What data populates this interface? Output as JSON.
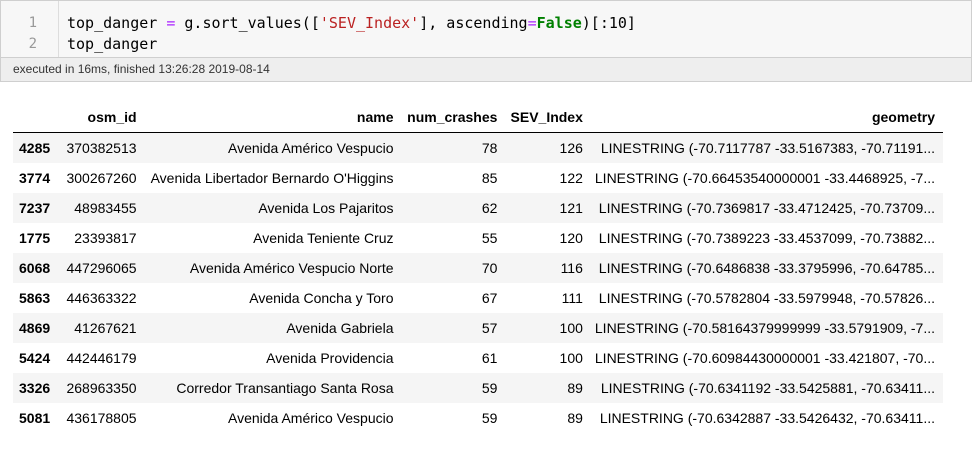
{
  "cell": {
    "line_numbers": [
      "1",
      "2"
    ],
    "code": {
      "line1": {
        "p1": "top_danger ",
        "eq1": "=",
        "p2": " g.sort_values([",
        "str": "'SEV_Index'",
        "p3": "], ascending",
        "eq2": "=",
        "kw": "False",
        "p4": ")[:10]"
      },
      "line2": "top_danger"
    },
    "execution_status": "executed in 16ms, finished 13:26:28 2019-08-14"
  },
  "table": {
    "columns": [
      "",
      "osm_id",
      "name",
      "num_crashes",
      "SEV_Index",
      "geometry"
    ],
    "rows": [
      {
        "index": "4285",
        "osm_id": "370382513",
        "name": "Avenida Américo Vespucio",
        "num_crashes": "78",
        "sev_index": "126",
        "geometry": "LINESTRING (-70.7117787 -33.5167383, -70.71191..."
      },
      {
        "index": "3774",
        "osm_id": "300267260",
        "name": "Avenida Libertador Bernardo O'Higgins",
        "num_crashes": "85",
        "sev_index": "122",
        "geometry": "LINESTRING (-70.66453540000001 -33.4468925, -7..."
      },
      {
        "index": "7237",
        "osm_id": "48983455",
        "name": "Avenida Los Pajaritos",
        "num_crashes": "62",
        "sev_index": "121",
        "geometry": "LINESTRING (-70.7369817 -33.4712425, -70.73709..."
      },
      {
        "index": "1775",
        "osm_id": "23393817",
        "name": "Avenida Teniente Cruz",
        "num_crashes": "55",
        "sev_index": "120",
        "geometry": "LINESTRING (-70.7389223 -33.4537099, -70.73882..."
      },
      {
        "index": "6068",
        "osm_id": "447296065",
        "name": "Avenida Américo Vespucio Norte",
        "num_crashes": "70",
        "sev_index": "116",
        "geometry": "LINESTRING (-70.6486838 -33.3795996, -70.64785..."
      },
      {
        "index": "5863",
        "osm_id": "446363322",
        "name": "Avenida Concha y Toro",
        "num_crashes": "67",
        "sev_index": "111",
        "geometry": "LINESTRING (-70.5782804 -33.5979948, -70.57826..."
      },
      {
        "index": "4869",
        "osm_id": "41267621",
        "name": "Avenida Gabriela",
        "num_crashes": "57",
        "sev_index": "100",
        "geometry": "LINESTRING (-70.58164379999999 -33.5791909, -7..."
      },
      {
        "index": "5424",
        "osm_id": "442446179",
        "name": "Avenida Providencia",
        "num_crashes": "61",
        "sev_index": "100",
        "geometry": "LINESTRING (-70.60984430000001 -33.421807, -70..."
      },
      {
        "index": "3326",
        "osm_id": "268963350",
        "name": "Corredor Transantiago Santa Rosa",
        "num_crashes": "59",
        "sev_index": "89",
        "geometry": "LINESTRING (-70.6341192 -33.5425881, -70.63411..."
      },
      {
        "index": "5081",
        "osm_id": "436178805",
        "name": "Avenida Américo Vespucio",
        "num_crashes": "59",
        "sev_index": "89",
        "geometry": "LINESTRING (-70.6342887 -33.5426432, -70.63411..."
      }
    ]
  }
}
